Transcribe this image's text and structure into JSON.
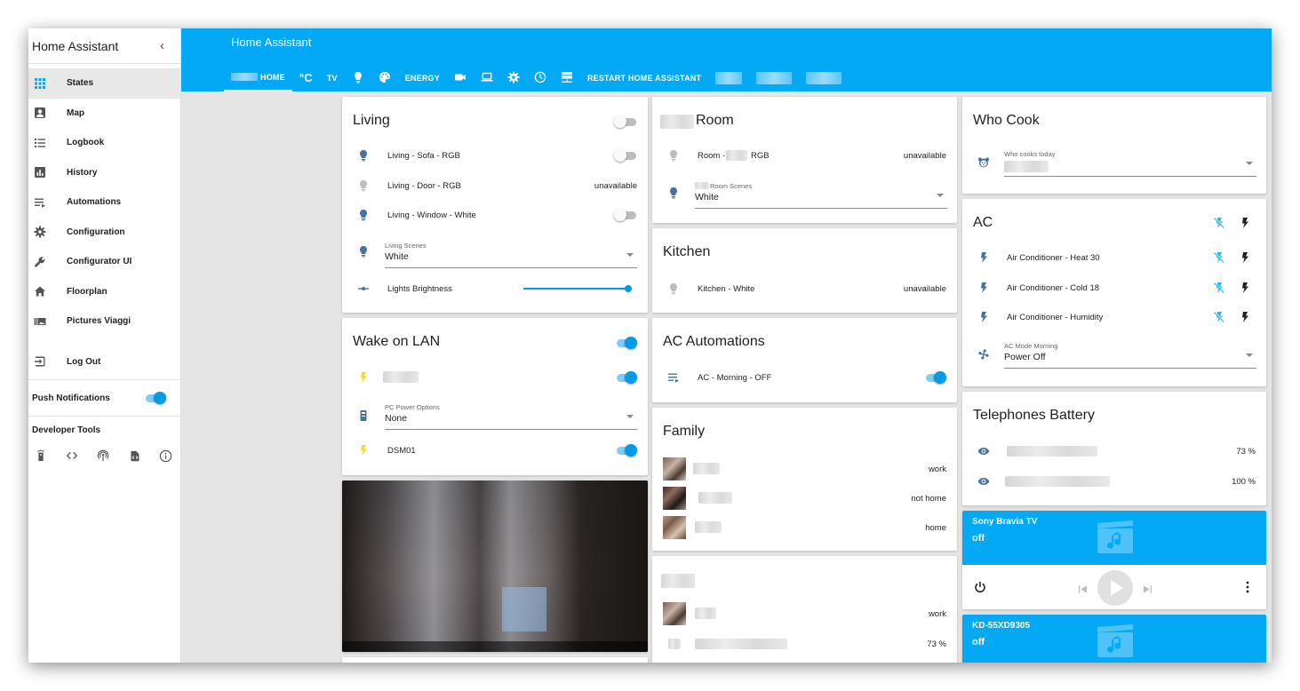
{
  "sidebar": {
    "title": "Home Assistant",
    "items": [
      {
        "label": "States",
        "icon": "grid-icon"
      },
      {
        "label": "Map",
        "icon": "account-box-icon"
      },
      {
        "label": "Logbook",
        "icon": "list-icon"
      },
      {
        "label": "History",
        "icon": "chart-icon"
      },
      {
        "label": "Automations",
        "icon": "playlist-play-icon"
      },
      {
        "label": "Configuration",
        "icon": "gear-icon"
      },
      {
        "label": "Configurator UI",
        "icon": "wrench-icon"
      },
      {
        "label": "Floorplan",
        "icon": "home-icon"
      },
      {
        "label": "Pictures Viaggi",
        "icon": "pictures-icon"
      },
      {
        "label": "Log Out",
        "icon": "exit-icon"
      }
    ],
    "push_notifications": "Push Notifications",
    "developer_tools": "Developer Tools"
  },
  "header": {
    "title": "Home Assistant",
    "tabs": {
      "home": "HOME",
      "celsius": "°C",
      "tv": "TV",
      "energy": "ENERGY",
      "restart": "RESTART HOME ASSISTANT"
    }
  },
  "living": {
    "title": "Living",
    "rows": [
      {
        "label": "Living - Sofa - RGB"
      },
      {
        "label": "Living - Door - RGB",
        "state": "unavailable"
      },
      {
        "label": "Living - Window - White"
      }
    ],
    "scenes_label": "Living Scenes",
    "scenes_value": "White",
    "brightness_label": "Lights Brightness"
  },
  "wol": {
    "title": "Wake on LAN",
    "pc_label": "PC Power Options",
    "pc_value": "None",
    "dsm": "DSM01"
  },
  "room": {
    "title": "Room",
    "light_prefix": "Room -",
    "light_suffix": "RGB",
    "light_state": "unavailable",
    "scenes_label": "Room Scenes",
    "scenes_value": "White"
  },
  "kitchen": {
    "title": "Kitchen",
    "light": "Kitchen - White",
    "state": "unavailable"
  },
  "ac_auto": {
    "title": "AC Automations",
    "row": "AC - Morning - OFF"
  },
  "family": {
    "title": "Family",
    "states": [
      "work",
      "not home",
      "home"
    ]
  },
  "group2": {
    "states": [
      "work",
      "73 %"
    ]
  },
  "who_cook": {
    "title": "Who Cook",
    "label": "Who cooks today"
  },
  "ac": {
    "title": "AC",
    "rows": [
      {
        "label": "Air Conditioner - Heat 30"
      },
      {
        "label": "Air Conditioner - Cold 18"
      },
      {
        "label": "Air Conditioner - Humidity"
      }
    ],
    "mode_label": "AC Mode Morning",
    "mode_value": "Power Off"
  },
  "battery": {
    "title": "Telephones Battery",
    "values": [
      "73 %",
      "100 %"
    ]
  },
  "media1": {
    "name": "Sony Bravia TV",
    "state": "off"
  },
  "media2": {
    "name": "KD-55XD9305",
    "state": "off"
  },
  "colors": {
    "primary": "#03a9f4",
    "accent": "#039be5",
    "icon_blue": "#44739e",
    "bolt_yellow": "#fdd835"
  }
}
